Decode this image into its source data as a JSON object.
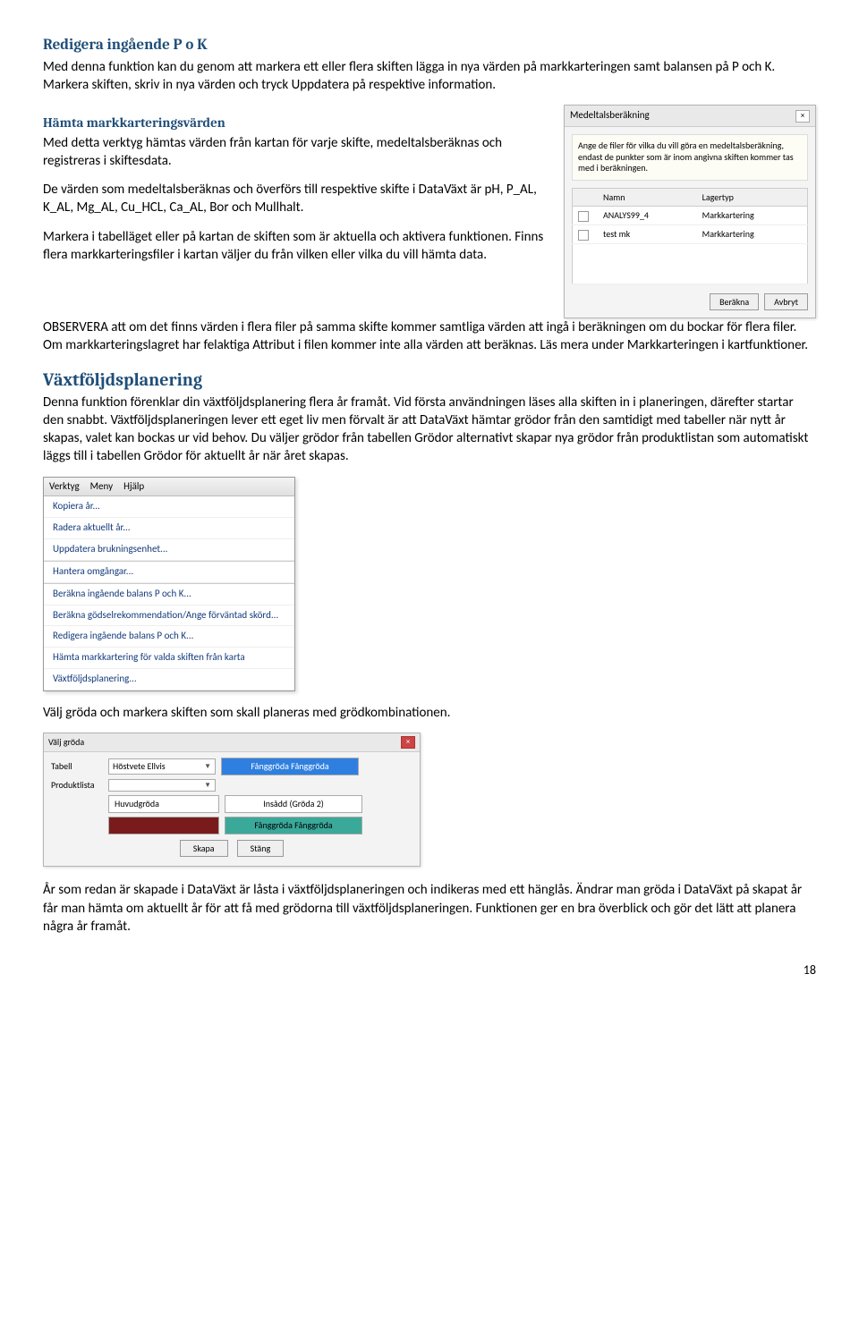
{
  "sections": {
    "redigera": {
      "heading": "Redigera ingående P o K",
      "p1": "Med denna funktion kan du genom att markera ett eller flera skiften lägga in nya värden på markkarteringen samt balansen på P och K. Markera skiften, skriv in nya värden och tryck Uppdatera på respektive information."
    },
    "hamta": {
      "heading": "Hämta markkarteringsvärden",
      "p1": "Med detta verktyg hämtas värden från kartan för varje skifte, medeltalsberäknas och registreras i skiftesdata.",
      "p2": "De värden som medeltalsberäknas och överförs till respektive skifte i DataVäxt är pH, P_AL, K_AL, Mg_AL, Cu_HCL, Ca_AL, Bor och Mullhalt.",
      "p3": "Markera i tabelläget eller på kartan de skiften som är aktuella och aktivera funktionen. Finns flera markkarteringsfiler i kartan väljer du från vilken eller vilka du vill hämta data.",
      "p4": "OBSERVERA att om det finns värden i flera filer på samma skifte kommer samtliga värden att ingå i beräkningen om du bockar för flera filer. Om markkarteringslagret har felaktiga Attribut i filen kommer inte alla värden att beräknas. Läs mera under Markkarteringen i kartfunktioner."
    },
    "vaxt": {
      "heading": "Växtföljdsplanering",
      "p1": "Denna funktion förenklar din växtföljdsplanering flera år framåt. Vid första användningen läses alla skiften in i planeringen, därefter startar den snabbt. Växtföljdsplaneringen lever ett eget liv men förvalt är att DataVäxt hämtar grödor från den samtidigt med tabeller när nytt år skapas, valet kan bockas ur vid behov. Du väljer grödor från tabellen Grödor alternativt skapar nya grödor från produktlistan som automatiskt läggs till i tabellen Grödor för aktuellt år när året skapas.",
      "p2": "Välj gröda och markera skiften som skall planeras med grödkombinationen.",
      "p3": "År som redan är skapade i DataVäxt är låsta i växtföljdsplaneringen och indikeras med ett hänglås. Ändrar man gröda i DataVäxt på skapat år får man hämta om aktuellt år för att få med grödorna till växtföljdsplaneringen. Funktionen ger en bra överblick och gör det lätt att planera några år framåt."
    }
  },
  "dlg": {
    "title": "Medeltalsberäkning",
    "info": "Ange de filer för vilka du vill göra en medeltalsberäkning, endast de punkter som är inom angivna skiften kommer tas med i beräkningen.",
    "col1": "Namn",
    "col2": "Lagertyp",
    "rows": [
      {
        "name": "ANALYS99_4",
        "type": "Markkartering"
      },
      {
        "name": "test mk",
        "type": "Markkartering"
      }
    ],
    "btn_calc": "Beräkna",
    "btn_cancel": "Avbryt"
  },
  "menu": {
    "top": [
      "Verktyg",
      "Meny",
      "Hjälp"
    ],
    "items": [
      "Kopiera år...",
      "Radera aktuellt år...",
      "Uppdatera brukningsenhet...",
      "-",
      "Hantera omgångar...",
      "-",
      "Beräkna ingående balans P och K...",
      "Beräkna gödselrekommendation/Ange förväntad skörd...",
      "Redigera ingående balans P och K...",
      "Hämta markkartering för valda skiften från karta",
      "Växtföljdsplanering..."
    ]
  },
  "groda": {
    "title": "Välj gröda",
    "label_tabell": "Tabell",
    "drop_tabell": "Höstvete Ellvis",
    "label_prod": "Produktlista",
    "label_huvud": "Huvudgröda",
    "label_insadd": "Insådd (Gröda 2)",
    "cell_fang": "Fånggröda Fånggröda",
    "cell_hi": "Fånggröda Fånggröda",
    "btn_create": "Skapa",
    "btn_close": "Stäng"
  },
  "page_number": "18"
}
